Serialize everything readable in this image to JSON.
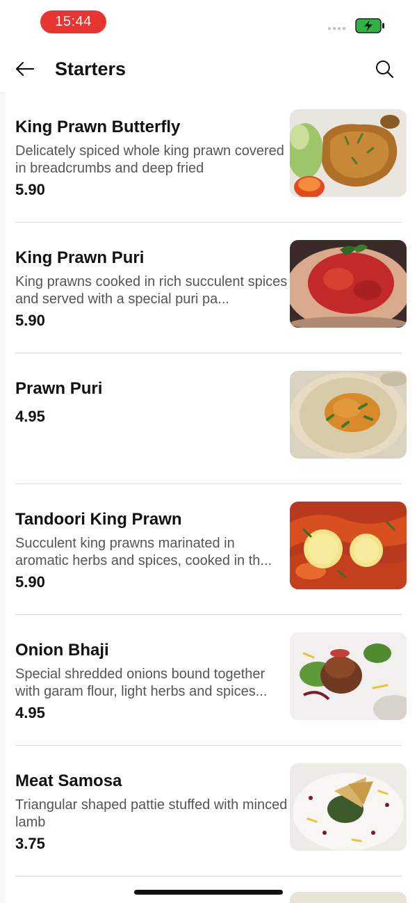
{
  "status_bar": {
    "time": "15:44",
    "time_pill_color": "#e8352f",
    "battery_icon": "battery-charging-icon",
    "battery_color": "#2fb344"
  },
  "header": {
    "title": "Starters",
    "back_icon": "arrow-left-icon",
    "search_icon": "search-icon"
  },
  "menu": {
    "items": [
      {
        "name": "King Prawn Butterfly",
        "description": "Delicately spiced whole king prawn covered in breadcrumbs and deep fried",
        "price": "5.90",
        "image_icon": "fried-prawn-photo"
      },
      {
        "name": "King Prawn Puri",
        "description": "King prawns cooked in rich succulent spices and served with a special puri pa...",
        "price": "5.90",
        "image_icon": "prawn-puri-photo"
      },
      {
        "name": "Prawn Puri",
        "description": "",
        "price": "4.95",
        "image_icon": "prawn-puri-bread-photo"
      },
      {
        "name": "Tandoori King Prawn",
        "description": "Succulent king prawns marinated in aromatic herbs and spices, cooked in th...",
        "price": "5.90",
        "image_icon": "tandoori-prawn-photo"
      },
      {
        "name": "Onion Bhaji",
        "description": "Special shredded onions bound together with garam flour, light herbs and spices...",
        "price": "4.95",
        "image_icon": "onion-bhaji-photo"
      },
      {
        "name": "Meat Samosa",
        "description": "Triangular shaped pattie stuffed with minced lamb",
        "price": "3.75",
        "image_icon": "samosa-photo"
      }
    ]
  }
}
